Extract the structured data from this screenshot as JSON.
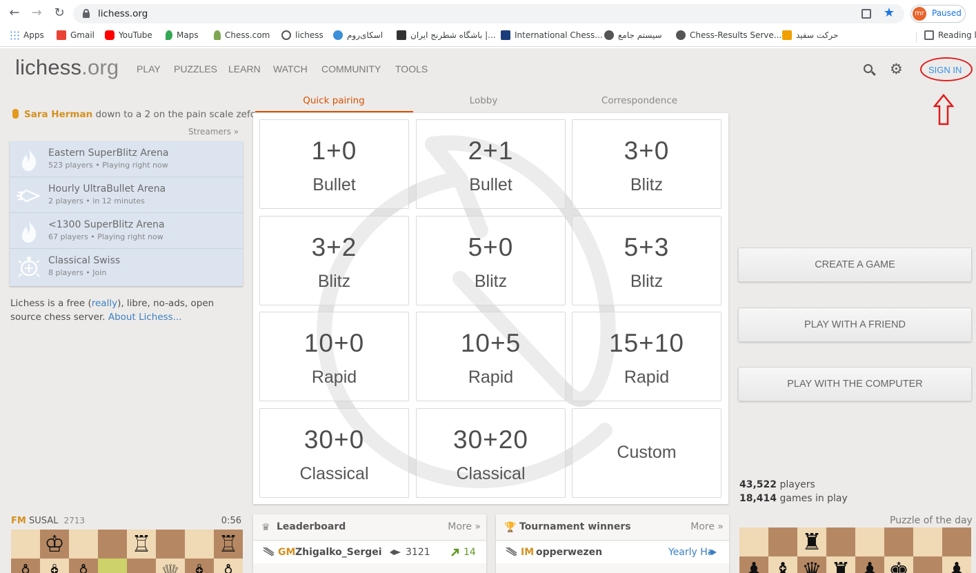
{
  "browser": {
    "url": "lichess.org",
    "profile_initials": "mr",
    "profile_status": "Paused",
    "bookmarks": [
      {
        "label": "Apps",
        "color": "#4285f4"
      },
      {
        "label": "Gmail",
        "color": "#ea4335"
      },
      {
        "label": "YouTube",
        "color": "#ff0000"
      },
      {
        "label": "Maps",
        "color": "#34a853"
      },
      {
        "label": "Chess.com",
        "color": "#7fa650"
      },
      {
        "label": "lichess",
        "color": "#555555"
      },
      {
        "label": "اسکای‌روم",
        "color": "#3a8fd8"
      },
      {
        "label": "باشگاه شطرنج ایران |...",
        "color": "#333333"
      },
      {
        "label": "International Chess...",
        "color": "#1b3c7a"
      },
      {
        "label": "سیستم جامع",
        "color": "#555555"
      },
      {
        "label": "Chess-Results Serve...",
        "color": "#555555"
      },
      {
        "label": "حرکت سفید",
        "color": "#f0a000"
      },
      {
        "label": "Reading li",
        "color": "#5f6368"
      }
    ]
  },
  "header": {
    "logo_main": "lichess",
    "logo_tld": ".org",
    "nav": [
      "PLAY",
      "PUZZLES",
      "LEARN",
      "WATCH",
      "COMMUNITY",
      "TOOLS"
    ],
    "signin": "SIGN IN"
  },
  "streamer": {
    "name": "Sara Herman",
    "status": "down to a 2 on the pain scale zefc...",
    "link": "Streamers »"
  },
  "tournaments": [
    {
      "name": "Eastern SuperBlitz Arena",
      "info": "523 players • Playing right now",
      "icon": "fire-icon"
    },
    {
      "name": "Hourly UltraBullet Arena",
      "info": "2 players •  in 12 minutes",
      "icon": "rocket-icon"
    },
    {
      "name": "<1300 SuperBlitz Arena",
      "info": "67 players • Playing right now",
      "icon": "fire-icon"
    },
    {
      "name": "Classical Swiss",
      "info": "8 players • Join",
      "icon": "turtle-icon"
    }
  ],
  "about": {
    "text1": "Lichess is a free (",
    "really": "really",
    "text2": "), libre, no-ads, open source chess server.",
    "link": "About Lichess..."
  },
  "lobby_tabs": [
    "Quick pairing",
    "Lobby",
    "Correspondence"
  ],
  "pairings": [
    {
      "clock": "1+0",
      "perf": "Bullet"
    },
    {
      "clock": "2+1",
      "perf": "Bullet"
    },
    {
      "clock": "3+0",
      "perf": "Blitz"
    },
    {
      "clock": "3+2",
      "perf": "Blitz"
    },
    {
      "clock": "5+0",
      "perf": "Blitz"
    },
    {
      "clock": "5+3",
      "perf": "Blitz"
    },
    {
      "clock": "10+0",
      "perf": "Rapid"
    },
    {
      "clock": "10+5",
      "perf": "Rapid"
    },
    {
      "clock": "15+10",
      "perf": "Rapid"
    },
    {
      "clock": "30+0",
      "perf": "Classical"
    },
    {
      "clock": "30+20",
      "perf": "Classical"
    }
  ],
  "custom_label": "Custom",
  "actions": {
    "create": "CREATE A GAME",
    "friend": "PLAY WITH A FRIEND",
    "computer": "PLAY WITH THE COMPUTER"
  },
  "counts": {
    "players_num": "43,522",
    "players_label": " players",
    "games_num": "18,414",
    "games_label": " games in play"
  },
  "mini_game": {
    "title": "FM",
    "name": "SUSAL",
    "rating": "2713",
    "clock": "0:56"
  },
  "leaderboard": {
    "title": "Leaderboard",
    "more": "More »",
    "player_title": "GM",
    "player_name": "Zhigalko_Sergei",
    "rating": "3121",
    "progress": "14"
  },
  "winners": {
    "title": "Tournament winners",
    "more": "More »",
    "player_title": "IM",
    "player_name": "opperwezen",
    "event": "Yearly Ha"
  },
  "puzzle": {
    "label": "Puzzle of the day"
  },
  "colors": {
    "accent_orange": "#d59020",
    "link_blue": "#3b7fc4",
    "annotation_red": "#e01b1b",
    "board_light": "#f0d9b5",
    "board_dark": "#b58863"
  }
}
